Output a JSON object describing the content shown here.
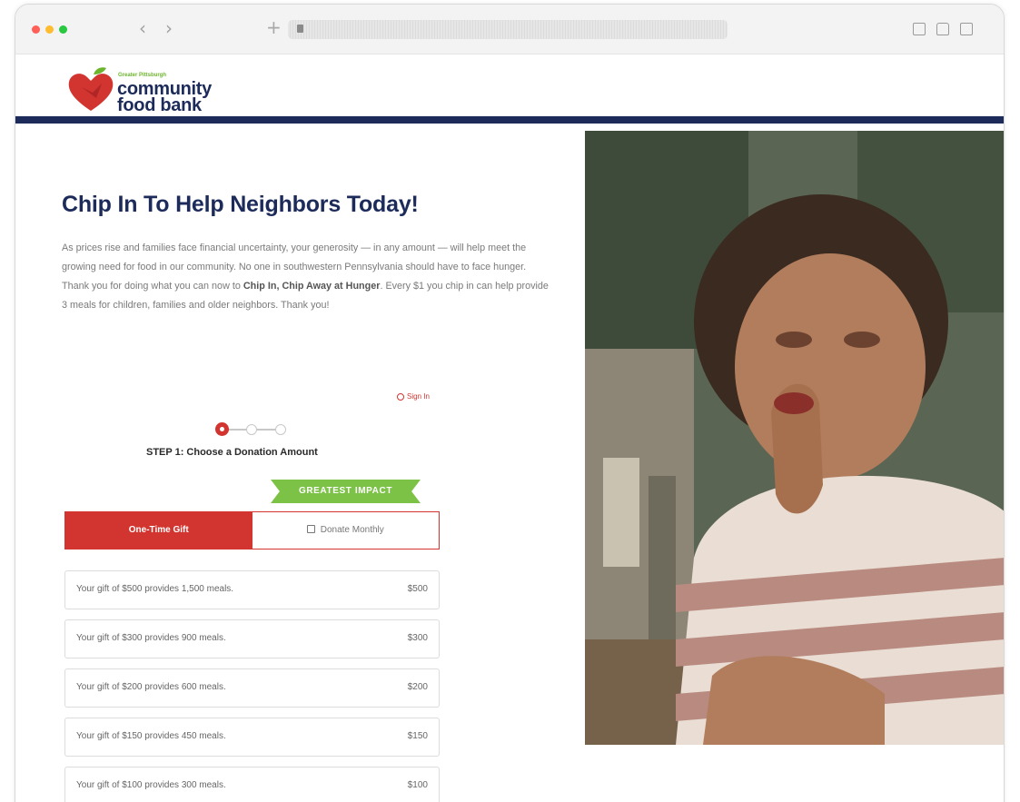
{
  "logo": {
    "small_text": "Greater Pittsburgh",
    "line1": "community",
    "line2": "food bank"
  },
  "hero": {
    "title": "Chip In To Help Neighbors Today!",
    "intro_part1": "As prices rise and families face financial uncertainty, your generosity — in any amount — will help meet the growing need for food in our community. No one in southwestern Pennsylvania should have to face hunger. Thank you for doing what you can now to ",
    "intro_bold": "Chip In, Chip Away at Hunger",
    "intro_part2": ". Every $1 you chip in can help provide 3 meals for children, families and older neighbors. Thank you!"
  },
  "signin": {
    "label": "Sign In"
  },
  "steps": {
    "title": "STEP 1: Choose a Donation Amount"
  },
  "ribbon": {
    "label": "GREATEST IMPACT"
  },
  "gift_type": {
    "one_time": "One-Time Gift",
    "monthly": "Donate Monthly"
  },
  "amounts": [
    {
      "text": "Your gift of $500 provides 1,500 meals.",
      "value": "$500"
    },
    {
      "text": "Your gift of $300 provides 900 meals.",
      "value": "$300"
    },
    {
      "text": "Your gift of $200 provides 600 meals.",
      "value": "$200"
    },
    {
      "text": "Your gift of $150 provides 450 meals.",
      "value": "$150"
    },
    {
      "text": "Your gift of $100 provides 300 meals.",
      "value": "$100"
    }
  ],
  "colors": {
    "navy": "#1c2b5a",
    "red": "#d2342f",
    "green": "#7cc247"
  }
}
